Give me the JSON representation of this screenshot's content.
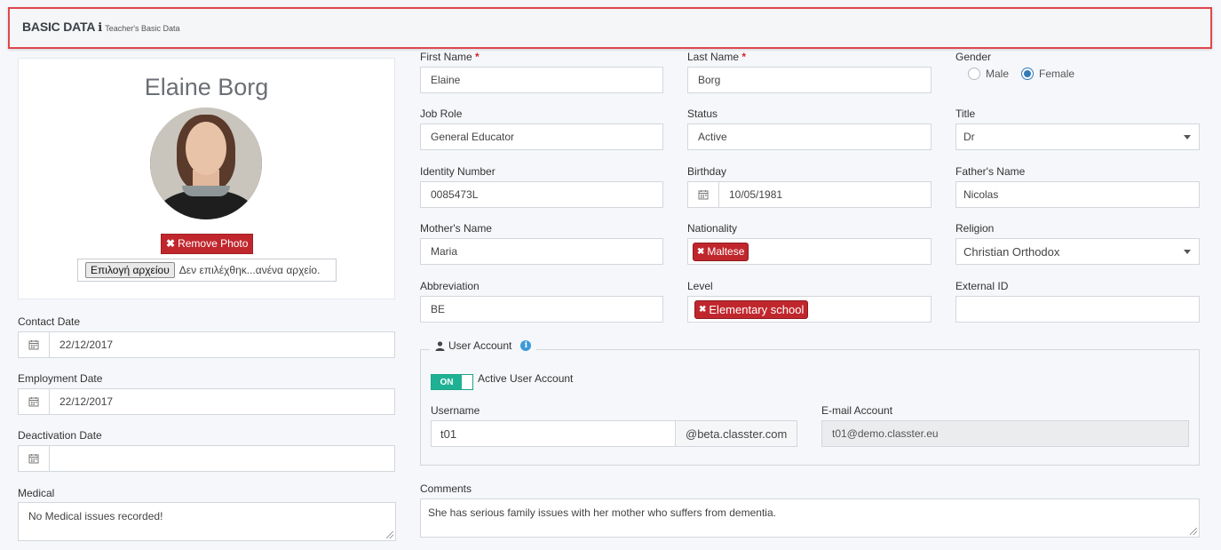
{
  "header": {
    "title": "BASIC DATA",
    "info_glyph": "i",
    "subtitle": "Teacher's Basic Data"
  },
  "profile": {
    "name": "Elaine Borg",
    "remove_photo_label": "Remove Photo",
    "file_button_label": "Επιλογή αρχείου",
    "file_status": "Δεν επιλέχθηκ...ανένα αρχείο."
  },
  "left_fields": {
    "contact_date": {
      "label": "Contact Date",
      "value": "22/12/2017"
    },
    "employment_date": {
      "label": "Employment Date",
      "value": "22/12/2017"
    },
    "deactivation_date": {
      "label": "Deactivation Date",
      "value": ""
    },
    "medical": {
      "label": "Medical",
      "value": "No Medical issues recorded!"
    }
  },
  "form": {
    "first_name": {
      "label": "First Name",
      "required": "*",
      "value": "Elaine"
    },
    "last_name": {
      "label": "Last Name",
      "required": "*",
      "value": "Borg"
    },
    "gender": {
      "label": "Gender",
      "options": [
        "Male",
        "Female"
      ],
      "selected": "Female"
    },
    "job_role": {
      "label": "Job Role",
      "value": "General Educator"
    },
    "status": {
      "label": "Status",
      "value": "Active"
    },
    "title": {
      "label": "Title",
      "value": "Dr"
    },
    "identity_number": {
      "label": "Identity Number",
      "value": "0085473L"
    },
    "birthday": {
      "label": "Birthday",
      "value": "10/05/1981"
    },
    "fathers_name": {
      "label": "Father's Name",
      "value": "Nicolas"
    },
    "mothers_name": {
      "label": "Mother's Name",
      "value": "Maria"
    },
    "nationality": {
      "label": "Nationality",
      "tags": [
        "Maltese"
      ]
    },
    "religion": {
      "label": "Religion",
      "value": "Christian Orthodox"
    },
    "abbreviation": {
      "label": "Abbreviation",
      "value": "BE"
    },
    "level": {
      "label": "Level",
      "tags": [
        "Elementary school"
      ]
    },
    "external_id": {
      "label": "External ID",
      "value": ""
    },
    "comments": {
      "label": "Comments",
      "value": "She has serious family issues with her mother who suffers from dementia."
    }
  },
  "user_account": {
    "legend": "User Account",
    "toggle_label": "ON",
    "toggle_state": "on",
    "active_label": "Active User Account",
    "username_label": "Username",
    "username_value": "t01",
    "domain_suffix": "@beta.classter.com",
    "email_label": "E-mail Account",
    "email_value": "t01@demo.classter.eu"
  },
  "colors": {
    "header_border": "#e0474c",
    "danger": "#c0272d",
    "toggle_on": "#1fb193",
    "radio_selected": "#337ab7",
    "info": "#3d9ad9"
  },
  "icons": [
    "info-icon",
    "close-icon",
    "calendar-icon",
    "user-icon",
    "chevron-down-icon"
  ]
}
